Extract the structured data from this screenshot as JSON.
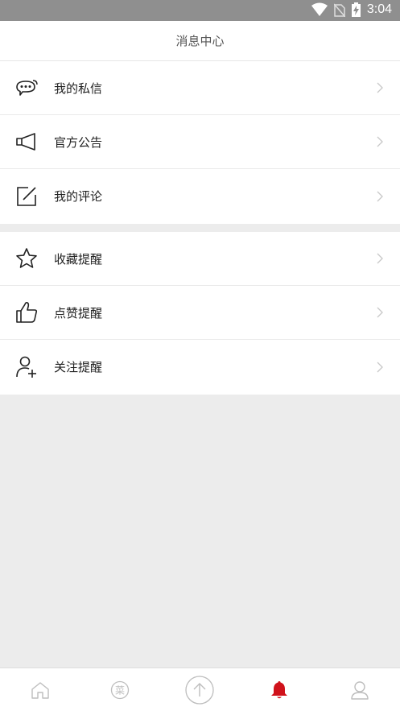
{
  "status_bar": {
    "time": "3:04",
    "icons": [
      "wifi-icon",
      "no-sim-icon",
      "battery-charging-icon"
    ]
  },
  "header": {
    "title": "消息中心"
  },
  "groups": [
    {
      "items": [
        {
          "label": "我的私信",
          "icon": "chat-bubble-icon"
        },
        {
          "label": "官方公告",
          "icon": "megaphone-icon"
        },
        {
          "label": "我的评论",
          "icon": "edit-icon"
        }
      ]
    },
    {
      "items": [
        {
          "label": "收藏提醒",
          "icon": "star-icon"
        },
        {
          "label": "点赞提醒",
          "icon": "thumbs-up-icon"
        },
        {
          "label": "关注提醒",
          "icon": "add-user-icon"
        }
      ]
    }
  ],
  "tabbar": {
    "tabs": [
      {
        "icon": "home-icon",
        "active": false
      },
      {
        "icon": "menu-circle-icon",
        "active": false
      },
      {
        "icon": "upload-circle-icon",
        "active": false
      },
      {
        "icon": "bell-icon",
        "active": true
      },
      {
        "icon": "profile-icon",
        "active": false
      }
    ],
    "menu_glyph": "菜"
  },
  "colors": {
    "accent": "#d0121b",
    "status_bar": "#8f8f8f",
    "background": "#ececec",
    "icon_inactive": "#bdbdbd"
  }
}
